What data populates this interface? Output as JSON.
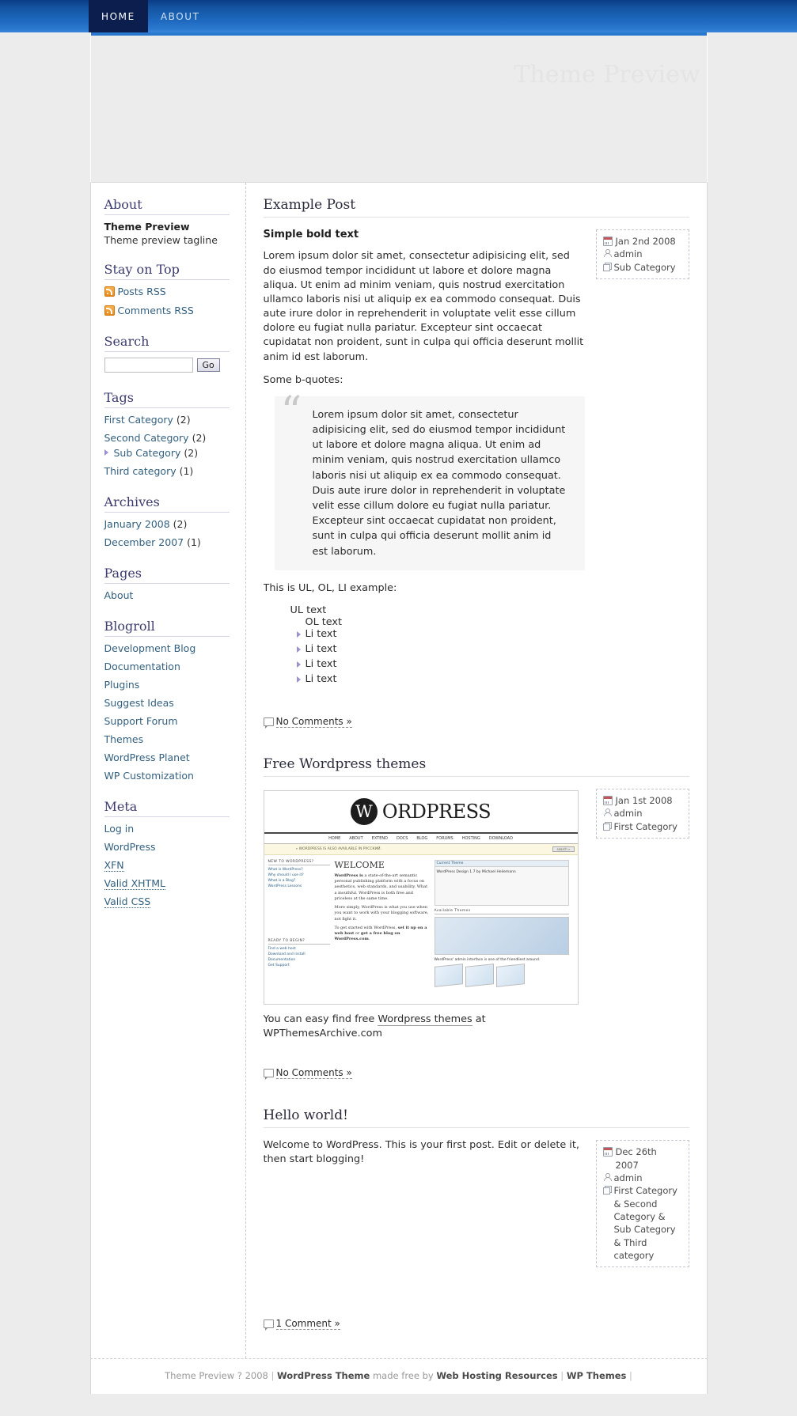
{
  "nav": {
    "items": [
      {
        "label": "Home",
        "active": true
      },
      {
        "label": "About",
        "active": false
      }
    ]
  },
  "header": {
    "blog_title": "Theme Preview"
  },
  "sidebar": {
    "about": {
      "heading": "About",
      "site_name": "Theme Preview",
      "tagline": "Theme preview tagline"
    },
    "stay_on_top": {
      "heading": "Stay on Top",
      "items": [
        {
          "label": "Posts RSS",
          "icon": "rss-icon"
        },
        {
          "label": "Comments RSS",
          "icon": "rss-icon"
        }
      ]
    },
    "search": {
      "heading": "Search",
      "value": "",
      "placeholder": "",
      "button_label": "Go"
    },
    "tags": {
      "heading": "Tags",
      "items": [
        {
          "label": "First Category",
          "count": "(2)",
          "sub": false
        },
        {
          "label": "Second Category",
          "count": "(2)",
          "sub": false
        },
        {
          "label": "Sub Category",
          "count": "(2)",
          "sub": true
        },
        {
          "label": "Third category",
          "count": "(1)",
          "sub": false
        }
      ]
    },
    "archives": {
      "heading": "Archives",
      "items": [
        {
          "label": "January 2008",
          "count": "(2)"
        },
        {
          "label": "December 2007",
          "count": "(1)"
        }
      ]
    },
    "pages": {
      "heading": "Pages",
      "items": [
        {
          "label": "About"
        }
      ]
    },
    "blogroll": {
      "heading": "Blogroll",
      "items": [
        {
          "label": "Development Blog"
        },
        {
          "label": "Documentation"
        },
        {
          "label": "Plugins"
        },
        {
          "label": "Suggest Ideas"
        },
        {
          "label": "Support Forum"
        },
        {
          "label": "Themes"
        },
        {
          "label": "WordPress Planet"
        },
        {
          "label": "WP Customization"
        }
      ]
    },
    "meta": {
      "heading": "Meta",
      "items": [
        {
          "label": "Log in",
          "abbr": false
        },
        {
          "label": "WordPress",
          "abbr": false
        },
        {
          "label": "XFN",
          "abbr": true
        },
        {
          "label": "Valid XHTML",
          "abbr": true
        },
        {
          "label": "Valid CSS",
          "abbr": true
        }
      ]
    }
  },
  "posts": {
    "post1": {
      "title": "Example Post",
      "meta": {
        "date": "Jan 2nd 2008",
        "author": "admin",
        "category": "Sub Category"
      },
      "bold_line": "Simple bold text",
      "p1": "Lorem ipsum dolor sit amet, consectetur adipisicing elit, sed do eiusmod tempor incididunt ut labore et dolore magna aliqua. Ut enim ad minim veniam, quis nostrud exercitation ullamco laboris nisi ut aliquip ex ea commodo consequat. Duis aute irure dolor in reprehenderit in voluptate velit esse cillum dolore eu fugiat nulla pariatur. Excepteur sint occaecat cupidatat non proident, sunt in culpa qui officia deserunt mollit anim id est laborum.",
      "p2": "Some b-quotes:",
      "blockquote": "Lorem ipsum dolor sit amet, consectetur adipisicing elit, sed do eiusmod tempor incididunt ut labore et dolore magna aliqua. Ut enim ad minim veniam, quis nostrud exercitation ullamco laboris nisi ut aliquip ex ea commodo consequat. Duis aute irure dolor in reprehenderit in voluptate velit esse cillum dolore eu fugiat nulla pariatur. Excepteur sint occaecat cupidatat non proident, sunt in culpa qui officia deserunt mollit anim id est laborum.",
      "p3": "This is UL, OL, LI example:",
      "ul_text": "UL text",
      "ol_text": "OL text",
      "li_items": [
        "Li text",
        "Li text",
        "Li text",
        "Li text"
      ],
      "comments_label": "No Comments »"
    },
    "post2": {
      "title": "Free Wordpress themes",
      "meta": {
        "date": "Jan 1st 2008",
        "author": "admin",
        "category": "First Category"
      },
      "caption_prefix": "You can easy find free ",
      "caption_link": "Wordpress themes",
      "caption_suffix": " at WPThemesArchive.com",
      "comments_label": "No Comments »",
      "screenshot": {
        "brand_letter": "W",
        "brand_word": "ORDPRESS",
        "nav": [
          "HOME",
          "ABOUT",
          "EXTEND",
          "DOCS",
          "BLOG",
          "FORUMS",
          "HOSTING",
          "DOWNLOAD"
        ],
        "notice": "» WORDPRESS IS ALSO AVAILABLE IN РУССКИЙ.",
        "search_button": "search »",
        "left_heading": "NEW TO WORDPRESS?",
        "left_items": [
          "What is WordPress?",
          "Why should I use it?",
          "What is a Blog?",
          "WordPress Lessons"
        ],
        "left_heading2": "READY TO BEGIN?",
        "left_items2": [
          "Find a web host",
          "Download and install",
          "Documentation",
          "Get Support"
        ],
        "welcome": "WELCOME",
        "body1_lead": "WordPress is",
        "body1": "a state-of-the-art semantic personal publishing platform with a focus on aesthetics, web standards, and usability. What a mouthful. WordPress is both free and priceless at the same time.",
        "body2": "More simply, WordPress is what you use when you want to work with your blogging software, not fight it.",
        "body3_pre": "To get started with WordPress, ",
        "body3_a": "set it up on a web host",
        "body3_mid": " or ",
        "body3_b": "get a free blog on WordPress.com",
        "body3_end": ".",
        "panel_heading": "Current Theme",
        "panel_line": "WordPress Design 1.7 by Michael Heilemann",
        "avail_heading": "Available Themes",
        "admin_caption": "WordPress' admin interface is one of the friendliest around."
      }
    },
    "post3": {
      "title": "Hello world!",
      "meta": {
        "date": "Dec 26th 2007",
        "author": "admin",
        "category": "First Category & Second Category & Sub Category & Third category"
      },
      "body": "Welcome to WordPress. This is your first post. Edit or delete it, then start blogging!",
      "comments_label": "1 Comment »"
    }
  },
  "footer": {
    "copyright": "Theme Preview ? 2008",
    "sep1": "|",
    "theme_label": "WordPress Theme",
    "made_free": "made free by",
    "sponsor": "Web Hosting Resources",
    "sep2": "|",
    "wp_themes": "WP Themes",
    "sep3": "|"
  },
  "colors": {
    "nav_bar_start": "#0b3c86",
    "nav_bar_end": "#3a86dd",
    "nav_active_bg": "#0b1e4e",
    "heading": "#3b3b6e",
    "link": "#33607f",
    "bullet": "#9b93d0"
  }
}
